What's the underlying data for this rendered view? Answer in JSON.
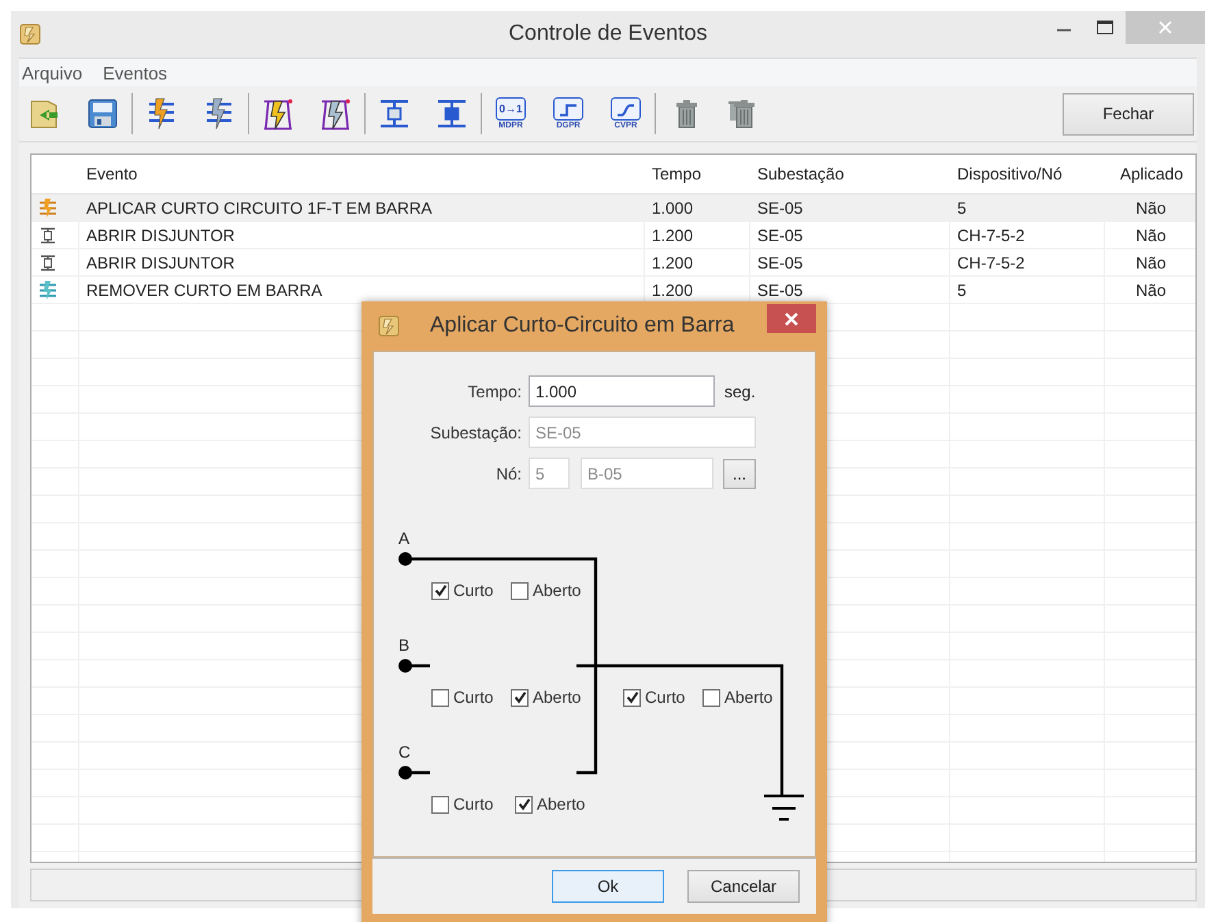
{
  "window": {
    "title": "Controle de Eventos"
  },
  "menu": [
    "Arquivo",
    "Eventos"
  ],
  "toolbar": [
    [
      {
        "kind": "open"
      },
      {
        "kind": "save"
      }
    ],
    [
      {
        "kind": "fault-lines"
      },
      {
        "kind": "fault-lines-off"
      }
    ],
    [
      {
        "kind": "fault-tower"
      },
      {
        "kind": "fault-tower-off"
      }
    ],
    [
      {
        "kind": "breaker-open"
      },
      {
        "kind": "breaker-closed"
      }
    ],
    [
      {
        "kind": "badge",
        "glyph": "0→1",
        "caption": "MDPR"
      },
      {
        "kind": "badge-step",
        "caption": "DGPR"
      },
      {
        "kind": "badge-ramp",
        "caption": "CVPR"
      }
    ],
    [
      {
        "kind": "trash"
      },
      {
        "kind": "trash-many"
      }
    ]
  ],
  "close_button": "Fechar",
  "table": {
    "columns": [
      "Evento",
      "Tempo",
      "Subestação",
      "Dispositivo/Nó",
      "Aplicado"
    ],
    "rows": [
      {
        "kind": "apply-fault",
        "selected": true,
        "cells": [
          "APLICAR CURTO CIRCUITO 1F-T EM BARRA",
          "1.000",
          "SE-05",
          "5",
          "Não"
        ]
      },
      {
        "kind": "open-breaker",
        "selected": false,
        "cells": [
          "ABRIR DISJUNTOR",
          "1.200",
          "SE-05",
          "CH-7-5-2",
          "Não"
        ]
      },
      {
        "kind": "open-breaker",
        "selected": false,
        "cells": [
          "ABRIR DISJUNTOR",
          "1.200",
          "SE-05",
          "CH-7-5-2",
          "Não"
        ]
      },
      {
        "kind": "remove-fault",
        "selected": false,
        "cells": [
          "REMOVER CURTO EM BARRA",
          "1.200",
          "SE-05",
          "5",
          "Não"
        ]
      }
    ]
  },
  "dialog": {
    "title": "Aplicar Curto-Circuito em Barra",
    "tempo": {
      "label": "Tempo:",
      "value": "1.000",
      "unit": "seg."
    },
    "subestacao": {
      "label": "Subestação:",
      "value": "SE-05",
      "disabled": true
    },
    "no": {
      "label": "Nó:",
      "number": "5",
      "name": "B-05",
      "browse": "...",
      "disabled": true
    },
    "phases": [
      {
        "label": "A",
        "options": [
          {
            "label": "Curto",
            "checked": true
          },
          {
            "label": "Aberto",
            "checked": false
          }
        ]
      },
      {
        "label": "B",
        "options": [
          {
            "label": "Curto",
            "checked": false
          },
          {
            "label": "Aberto",
            "checked": true
          }
        ]
      },
      {
        "label": "C",
        "options": [
          {
            "label": "Curto",
            "checked": false
          },
          {
            "label": "Aberto",
            "checked": true
          }
        ]
      }
    ],
    "ground": {
      "options": [
        {
          "label": "Curto",
          "checked": true
        },
        {
          "label": "Aberto",
          "checked": false
        }
      ]
    },
    "buttons": [
      {
        "label": "Ok",
        "default": true
      },
      {
        "label": "Cancelar",
        "default": false
      }
    ]
  }
}
